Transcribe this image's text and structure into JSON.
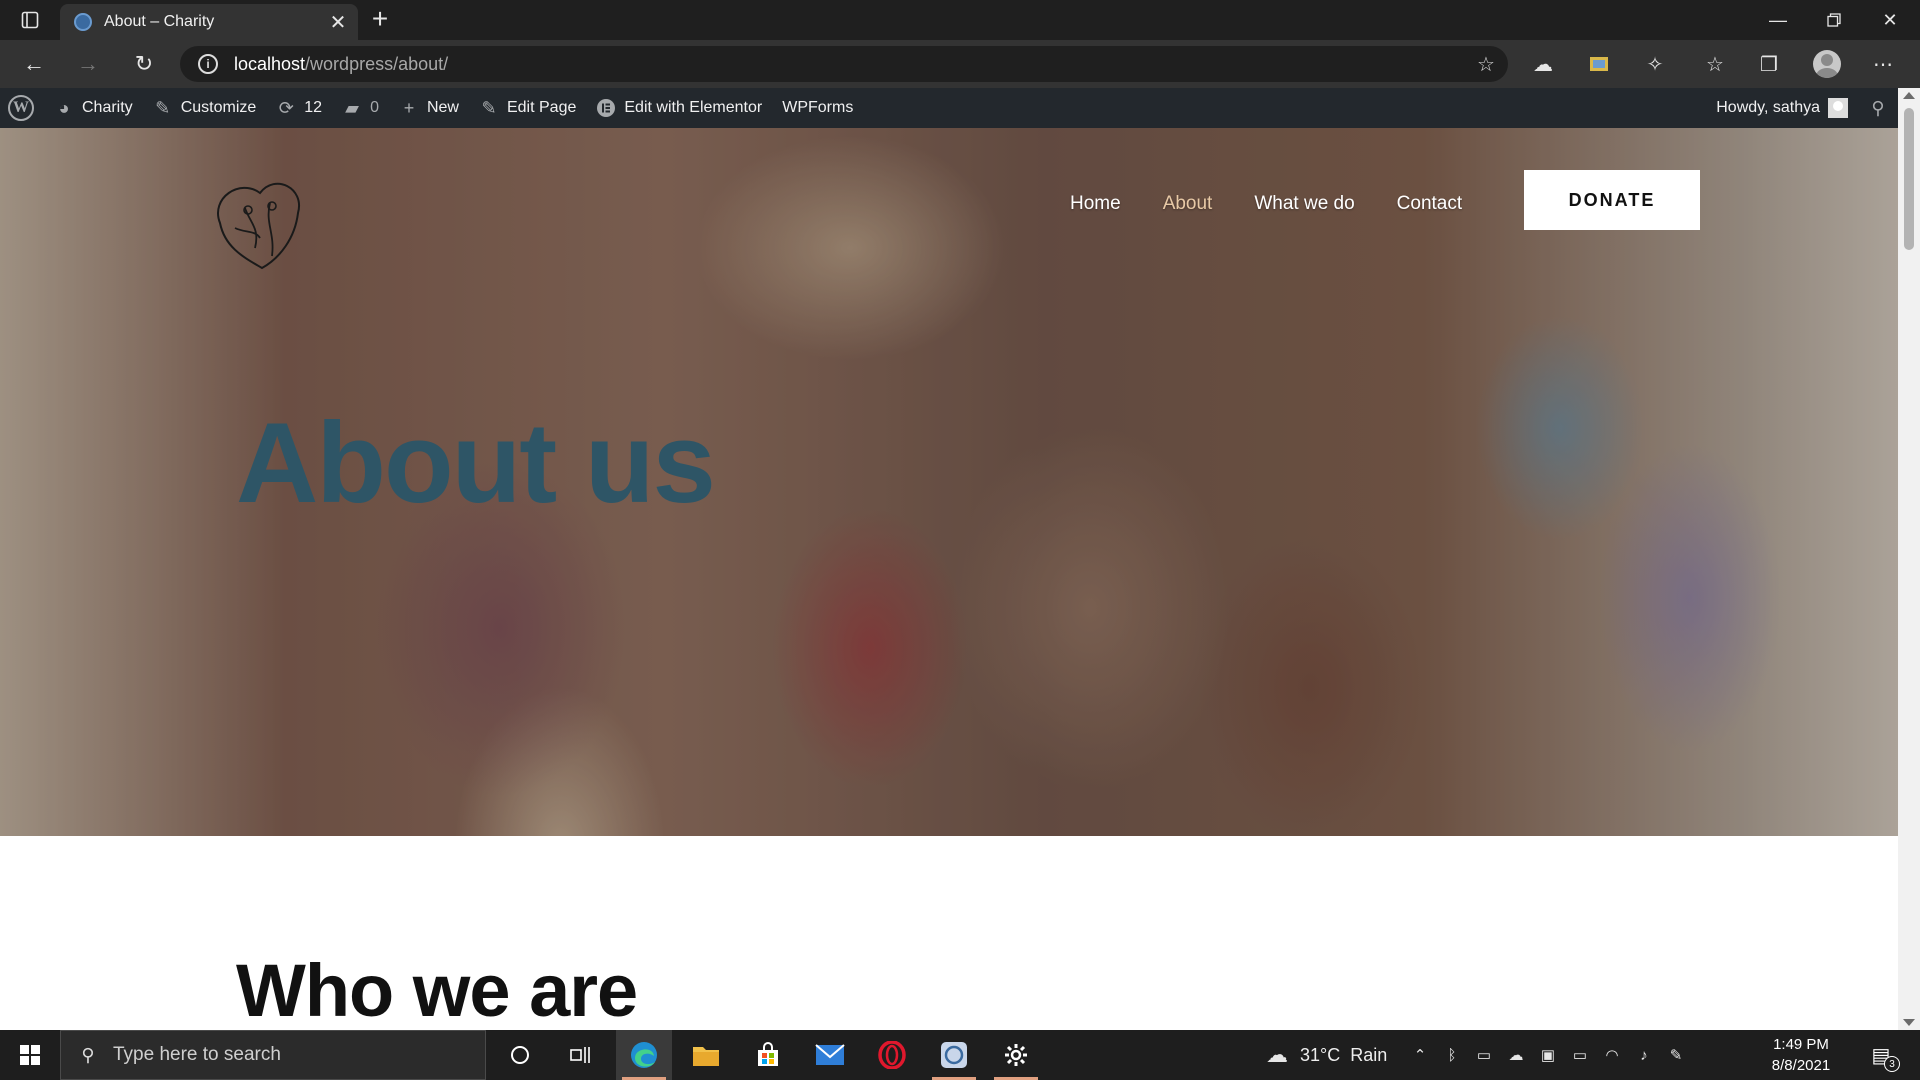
{
  "browser": {
    "tab_title": "About – Charity",
    "url_host": "localhost",
    "url_path": "/wordpress/about/"
  },
  "adminbar": {
    "site_name": "Charity",
    "customize": "Customize",
    "updates_count": "12",
    "comments_count": "0",
    "new_label": "New",
    "edit_page": "Edit Page",
    "edit_elementor": "Edit with Elementor",
    "wpforms": "WPForms",
    "howdy": "Howdy, sathya"
  },
  "site_nav": {
    "items": [
      "Home",
      "About",
      "What we do",
      "Contact"
    ],
    "donate": "DONATE"
  },
  "hero": {
    "title": "About us"
  },
  "content": {
    "section_title": "Who we are"
  },
  "taskbar": {
    "search_placeholder": "Type here to search",
    "weather": "31°C  Rain",
    "time": "1:49 PM",
    "date": "8/8/2021",
    "notification_count": "3"
  },
  "colors": {
    "hero_title": "#2e5566",
    "active_nav": "#e8c9a6",
    "adminbar_bg": "#23282d"
  }
}
